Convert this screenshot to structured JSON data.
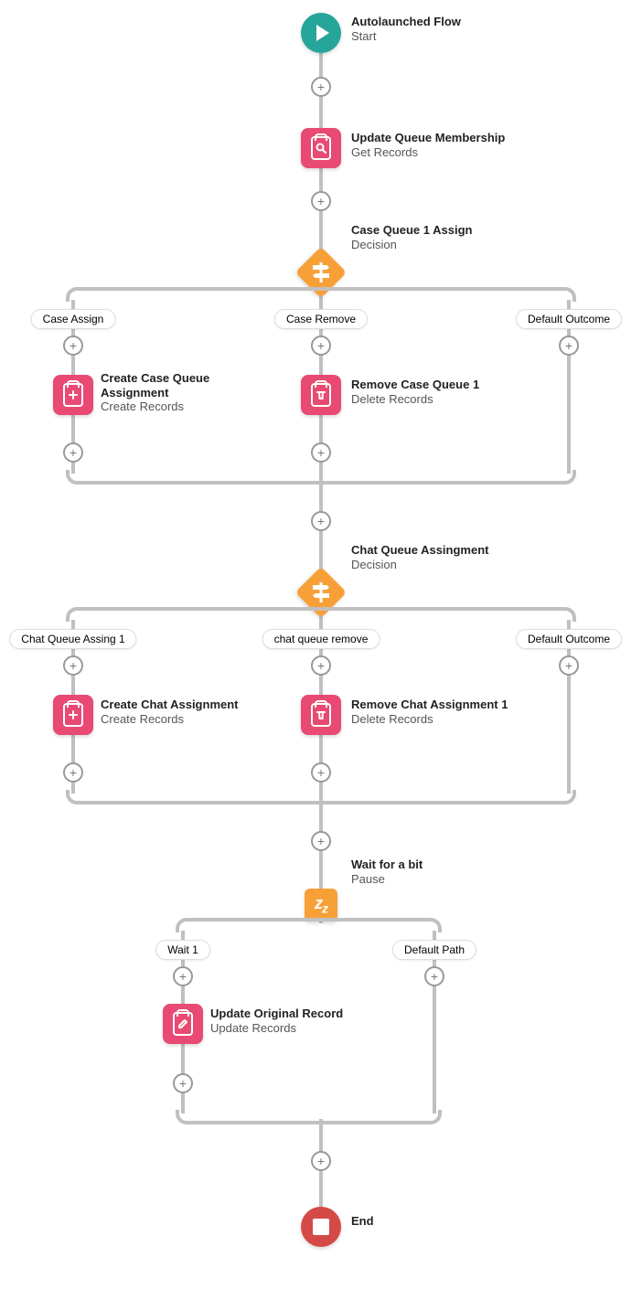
{
  "start": {
    "title": "Autolaunched Flow",
    "sub": "Start"
  },
  "n_get": {
    "title": "Update Queue Membership",
    "sub": "Get Records"
  },
  "dec1": {
    "title": "Case Queue 1 Assign",
    "sub": "Decision",
    "outcomes": [
      "Case Assign",
      "Case Remove",
      "Default Outcome"
    ]
  },
  "n_create_case": {
    "title": "Create Case Queue Assignment",
    "sub": "Create Records"
  },
  "n_remove_case": {
    "title": "Remove Case Queue 1",
    "sub": "Delete Records"
  },
  "dec2": {
    "title": "Chat Queue Assingment",
    "sub": "Decision",
    "outcomes": [
      "Chat Queue Assing 1",
      "chat queue remove",
      "Default Outcome"
    ]
  },
  "n_create_chat": {
    "title": "Create Chat Assignment",
    "sub": "Create Records"
  },
  "n_remove_chat": {
    "title": "Remove Chat Assignment 1",
    "sub": "Delete Records"
  },
  "pause": {
    "title": "Wait for a bit",
    "sub": "Pause",
    "outcomes": [
      "Wait 1",
      "Default Path"
    ]
  },
  "n_update": {
    "title": "Update Original Record",
    "sub": "Update Records"
  },
  "end": {
    "title": "End"
  }
}
